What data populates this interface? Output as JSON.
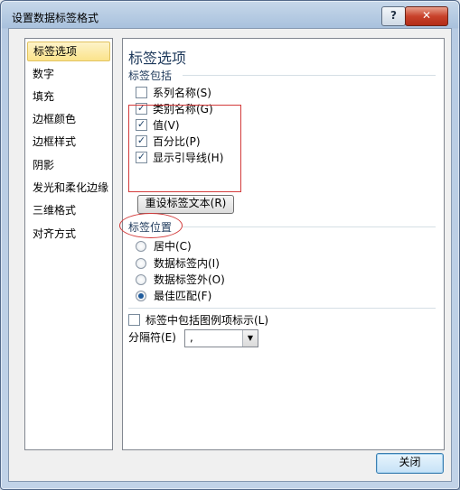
{
  "window": {
    "title": "设置数据标签格式",
    "help_label": "?",
    "close_label": "✕"
  },
  "sidebar": {
    "items": [
      {
        "label": "标签选项"
      },
      {
        "label": "数字"
      },
      {
        "label": "填充"
      },
      {
        "label": "边框颜色"
      },
      {
        "label": "边框样式"
      },
      {
        "label": "阴影"
      },
      {
        "label": "发光和柔化边缘"
      },
      {
        "label": "三维格式"
      },
      {
        "label": "对齐方式"
      }
    ],
    "selected": "标签选项"
  },
  "panel": {
    "heading": "标签选项",
    "contains_section": "标签包括",
    "checkboxes": [
      {
        "label": "系列名称(S)",
        "checked": false
      },
      {
        "label": "类别名称(G)",
        "checked": true
      },
      {
        "label": "值(V)",
        "checked": true
      },
      {
        "label": "百分比(P)",
        "checked": true
      },
      {
        "label": "显示引导线(H)",
        "checked": true
      }
    ],
    "reset_label": "重设标签文本(R)",
    "position_section": "标签位置",
    "radios": [
      {
        "label": "居中(C)",
        "selected": false
      },
      {
        "label": "数据标签内(I)",
        "selected": false
      },
      {
        "label": "数据标签外(O)",
        "selected": false
      },
      {
        "label": "最佳匹配(F)",
        "selected": true
      }
    ],
    "legend_key_label": "标签中包括图例项标示(L)",
    "legend_key_checked": false,
    "separator_label": "分隔符(E)",
    "separator_value": ","
  },
  "footer": {
    "close_label": "关闭"
  },
  "colors": {
    "annotation_red": "#d33b3b",
    "section_blue": "#1e395b"
  }
}
